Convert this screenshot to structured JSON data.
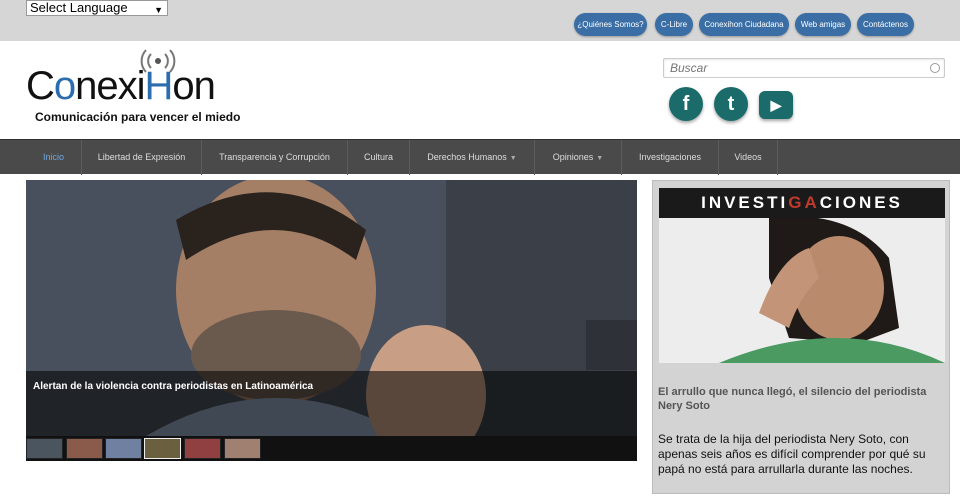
{
  "topbar": {
    "language_select": "Select Language",
    "links": [
      {
        "label": "¿Quiénes Somos?"
      },
      {
        "label": "C-Libre"
      },
      {
        "label": "Conexihon Ciudadana"
      },
      {
        "label": "Web amigas"
      },
      {
        "label": "Contáctenos"
      }
    ]
  },
  "header": {
    "logo_parts": [
      "C",
      "o",
      "nexi",
      "H",
      "on"
    ],
    "tagline": "Comunicación para vencer el miedo",
    "search_placeholder": "Buscar",
    "social": [
      {
        "icon": "facebook-icon",
        "glyph": "f"
      },
      {
        "icon": "twitter-icon",
        "glyph": "t"
      },
      {
        "icon": "youtube-icon",
        "glyph": "▶"
      }
    ]
  },
  "nav": {
    "items": [
      {
        "label": "Inicio",
        "active": true
      },
      {
        "label": "Libertad de Expresión"
      },
      {
        "label": "Transparencia y Corrupción"
      },
      {
        "label": "Cultura"
      },
      {
        "label": "Derechos Humanos",
        "dropdown": true
      },
      {
        "label": "Opiniones",
        "dropdown": true
      },
      {
        "label": "Investigaciones"
      },
      {
        "label": "Videos"
      }
    ]
  },
  "slider": {
    "caption": "Alertan de la violencia contra periodistas en Latinoamérica",
    "thumb_count": 6
  },
  "sidebar": {
    "banner_pre": "INVESTI",
    "banner_red": "GA",
    "banner_post": "CIONES",
    "title": "El arrullo que nunca llegó, el silencio del periodista Nery Soto",
    "text": "Se trata de la hija del periodista Nery Soto, con apenas seis años es difícil comprender por qué su papá no está para arrullarla durante las noches."
  },
  "colors": {
    "topbar_bg": "#d6d6d6",
    "pill_bg": "#3a6ea5",
    "nav_bg": "#4a4a4a",
    "nav_active": "#6fa8dc",
    "social_bg": "#1b6b6b",
    "brand_blue": "#2b6dad"
  }
}
